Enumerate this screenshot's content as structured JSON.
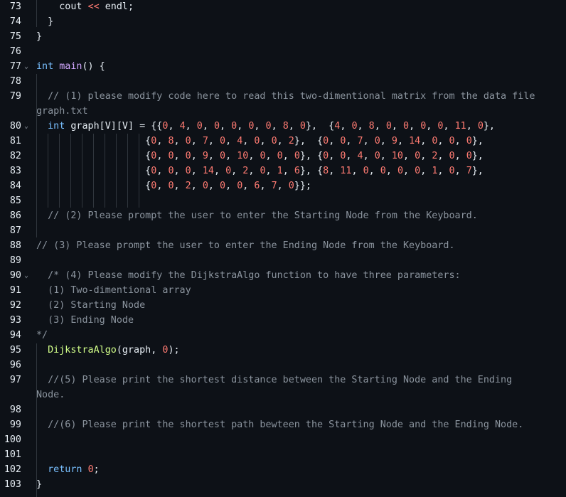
{
  "editor": {
    "lines": [
      {
        "n": "73",
        "fold": false,
        "segments": [
          [
            "plain",
            "    cout "
          ],
          [
            "op",
            "<<"
          ],
          [
            "plain",
            " endl;"
          ]
        ]
      },
      {
        "n": "74",
        "fold": false,
        "segments": [
          [
            "plain",
            "  }"
          ]
        ]
      },
      {
        "n": "75",
        "fold": false,
        "segments": [
          [
            "plain",
            "}"
          ]
        ]
      },
      {
        "n": "76",
        "fold": false,
        "segments": []
      },
      {
        "n": "77",
        "fold": true,
        "segments": [
          [
            "kw",
            "int"
          ],
          [
            "plain",
            " "
          ],
          [
            "fn",
            "main"
          ],
          [
            "plain",
            "() {"
          ]
        ]
      },
      {
        "n": "78",
        "fold": false,
        "segments": []
      },
      {
        "n": "79",
        "fold": false,
        "segments": [
          [
            "cm",
            "  // (1) please modify code here to read this two-dimentional matrix from the data file"
          ]
        ]
      },
      {
        "n": "",
        "fold": false,
        "segments": [
          [
            "cm",
            "graph.txt"
          ]
        ]
      },
      {
        "n": "80",
        "fold": true,
        "segments": [
          [
            "plain",
            "  "
          ],
          [
            "kw",
            "int"
          ],
          [
            "plain",
            " graph[V][V] = {{"
          ],
          [
            "num",
            "0"
          ],
          [
            "plain",
            ", "
          ],
          [
            "num",
            "4"
          ],
          [
            "plain",
            ", "
          ],
          [
            "num",
            "0"
          ],
          [
            "plain",
            ", "
          ],
          [
            "num",
            "0"
          ],
          [
            "plain",
            ", "
          ],
          [
            "num",
            "0"
          ],
          [
            "plain",
            ", "
          ],
          [
            "num",
            "0"
          ],
          [
            "plain",
            ", "
          ],
          [
            "num",
            "0"
          ],
          [
            "plain",
            ", "
          ],
          [
            "num",
            "8"
          ],
          [
            "plain",
            ", "
          ],
          [
            "num",
            "0"
          ],
          [
            "plain",
            "},  {"
          ],
          [
            "num",
            "4"
          ],
          [
            "plain",
            ", "
          ],
          [
            "num",
            "0"
          ],
          [
            "plain",
            ", "
          ],
          [
            "num",
            "8"
          ],
          [
            "plain",
            ", "
          ],
          [
            "num",
            "0"
          ],
          [
            "plain",
            ", "
          ],
          [
            "num",
            "0"
          ],
          [
            "plain",
            ", "
          ],
          [
            "num",
            "0"
          ],
          [
            "plain",
            ", "
          ],
          [
            "num",
            "0"
          ],
          [
            "plain",
            ", "
          ],
          [
            "num",
            "11"
          ],
          [
            "plain",
            ", "
          ],
          [
            "num",
            "0"
          ],
          [
            "plain",
            "},"
          ]
        ]
      },
      {
        "n": "81",
        "fold": false,
        "segments": [
          [
            "plain",
            "                   {"
          ],
          [
            "num",
            "0"
          ],
          [
            "plain",
            ", "
          ],
          [
            "num",
            "8"
          ],
          [
            "plain",
            ", "
          ],
          [
            "num",
            "0"
          ],
          [
            "plain",
            ", "
          ],
          [
            "num",
            "7"
          ],
          [
            "plain",
            ", "
          ],
          [
            "num",
            "0"
          ],
          [
            "plain",
            ", "
          ],
          [
            "num",
            "4"
          ],
          [
            "plain",
            ", "
          ],
          [
            "num",
            "0"
          ],
          [
            "plain",
            ", "
          ],
          [
            "num",
            "0"
          ],
          [
            "plain",
            ", "
          ],
          [
            "num",
            "2"
          ],
          [
            "plain",
            "},  {"
          ],
          [
            "num",
            "0"
          ],
          [
            "plain",
            ", "
          ],
          [
            "num",
            "0"
          ],
          [
            "plain",
            ", "
          ],
          [
            "num",
            "7"
          ],
          [
            "plain",
            ", "
          ],
          [
            "num",
            "0"
          ],
          [
            "plain",
            ", "
          ],
          [
            "num",
            "9"
          ],
          [
            "plain",
            ", "
          ],
          [
            "num",
            "14"
          ],
          [
            "plain",
            ", "
          ],
          [
            "num",
            "0"
          ],
          [
            "plain",
            ", "
          ],
          [
            "num",
            "0"
          ],
          [
            "plain",
            ", "
          ],
          [
            "num",
            "0"
          ],
          [
            "plain",
            "},"
          ]
        ]
      },
      {
        "n": "82",
        "fold": false,
        "segments": [
          [
            "plain",
            "                   {"
          ],
          [
            "num",
            "0"
          ],
          [
            "plain",
            ", "
          ],
          [
            "num",
            "0"
          ],
          [
            "plain",
            ", "
          ],
          [
            "num",
            "0"
          ],
          [
            "plain",
            ", "
          ],
          [
            "num",
            "9"
          ],
          [
            "plain",
            ", "
          ],
          [
            "num",
            "0"
          ],
          [
            "plain",
            ", "
          ],
          [
            "num",
            "10"
          ],
          [
            "plain",
            ", "
          ],
          [
            "num",
            "0"
          ],
          [
            "plain",
            ", "
          ],
          [
            "num",
            "0"
          ],
          [
            "plain",
            ", "
          ],
          [
            "num",
            "0"
          ],
          [
            "plain",
            "}, {"
          ],
          [
            "num",
            "0"
          ],
          [
            "plain",
            ", "
          ],
          [
            "num",
            "0"
          ],
          [
            "plain",
            ", "
          ],
          [
            "num",
            "4"
          ],
          [
            "plain",
            ", "
          ],
          [
            "num",
            "0"
          ],
          [
            "plain",
            ", "
          ],
          [
            "num",
            "10"
          ],
          [
            "plain",
            ", "
          ],
          [
            "num",
            "0"
          ],
          [
            "plain",
            ", "
          ],
          [
            "num",
            "2"
          ],
          [
            "plain",
            ", "
          ],
          [
            "num",
            "0"
          ],
          [
            "plain",
            ", "
          ],
          [
            "num",
            "0"
          ],
          [
            "plain",
            "},"
          ]
        ]
      },
      {
        "n": "83",
        "fold": false,
        "segments": [
          [
            "plain",
            "                   {"
          ],
          [
            "num",
            "0"
          ],
          [
            "plain",
            ", "
          ],
          [
            "num",
            "0"
          ],
          [
            "plain",
            ", "
          ],
          [
            "num",
            "0"
          ],
          [
            "plain",
            ", "
          ],
          [
            "num",
            "14"
          ],
          [
            "plain",
            ", "
          ],
          [
            "num",
            "0"
          ],
          [
            "plain",
            ", "
          ],
          [
            "num",
            "2"
          ],
          [
            "plain",
            ", "
          ],
          [
            "num",
            "0"
          ],
          [
            "plain",
            ", "
          ],
          [
            "num",
            "1"
          ],
          [
            "plain",
            ", "
          ],
          [
            "num",
            "6"
          ],
          [
            "plain",
            "}, {"
          ],
          [
            "num",
            "8"
          ],
          [
            "plain",
            ", "
          ],
          [
            "num",
            "11"
          ],
          [
            "plain",
            ", "
          ],
          [
            "num",
            "0"
          ],
          [
            "plain",
            ", "
          ],
          [
            "num",
            "0"
          ],
          [
            "plain",
            ", "
          ],
          [
            "num",
            "0"
          ],
          [
            "plain",
            ", "
          ],
          [
            "num",
            "0"
          ],
          [
            "plain",
            ", "
          ],
          [
            "num",
            "1"
          ],
          [
            "plain",
            ", "
          ],
          [
            "num",
            "0"
          ],
          [
            "plain",
            ", "
          ],
          [
            "num",
            "7"
          ],
          [
            "plain",
            "},"
          ]
        ]
      },
      {
        "n": "84",
        "fold": false,
        "segments": [
          [
            "plain",
            "                   {"
          ],
          [
            "num",
            "0"
          ],
          [
            "plain",
            ", "
          ],
          [
            "num",
            "0"
          ],
          [
            "plain",
            ", "
          ],
          [
            "num",
            "2"
          ],
          [
            "plain",
            ", "
          ],
          [
            "num",
            "0"
          ],
          [
            "plain",
            ", "
          ],
          [
            "num",
            "0"
          ],
          [
            "plain",
            ", "
          ],
          [
            "num",
            "0"
          ],
          [
            "plain",
            ", "
          ],
          [
            "num",
            "6"
          ],
          [
            "plain",
            ", "
          ],
          [
            "num",
            "7"
          ],
          [
            "plain",
            ", "
          ],
          [
            "num",
            "0"
          ],
          [
            "plain",
            "}};"
          ]
        ]
      },
      {
        "n": "85",
        "fold": false,
        "segments": []
      },
      {
        "n": "86",
        "fold": false,
        "segments": [
          [
            "cm",
            "  // (2) Please prompt the user to enter the Starting Node from the Keyboard."
          ]
        ]
      },
      {
        "n": "87",
        "fold": false,
        "segments": []
      },
      {
        "n": "88",
        "fold": false,
        "segments": [
          [
            "cm",
            "// (3) Please prompt the user to enter the Ending Node from the Keyboard."
          ]
        ]
      },
      {
        "n": "89",
        "fold": false,
        "segments": []
      },
      {
        "n": "90",
        "fold": true,
        "segments": [
          [
            "cm",
            "  /* (4) Please modify the DijkstraAlgo function to have three parameters:"
          ]
        ]
      },
      {
        "n": "91",
        "fold": false,
        "segments": [
          [
            "cm",
            "  (1) Two-dimentional array"
          ]
        ]
      },
      {
        "n": "92",
        "fold": false,
        "segments": [
          [
            "cm",
            "  (2) Starting Node"
          ]
        ]
      },
      {
        "n": "93",
        "fold": false,
        "segments": [
          [
            "cm",
            "  (3) Ending Node"
          ]
        ]
      },
      {
        "n": "94",
        "fold": false,
        "segments": [
          [
            "cm",
            "*/"
          ]
        ]
      },
      {
        "n": "95",
        "fold": false,
        "segments": [
          [
            "plain",
            "  "
          ],
          [
            "fn2",
            "DijkstraAlgo"
          ],
          [
            "plain",
            "(graph, "
          ],
          [
            "num",
            "0"
          ],
          [
            "plain",
            ");"
          ]
        ]
      },
      {
        "n": "96",
        "fold": false,
        "segments": []
      },
      {
        "n": "97",
        "fold": false,
        "segments": [
          [
            "cm",
            "  //(5) Please print the shortest distance between the Starting Node and the Ending"
          ]
        ]
      },
      {
        "n": "",
        "fold": false,
        "segments": [
          [
            "cm",
            "Node."
          ]
        ]
      },
      {
        "n": "98",
        "fold": false,
        "segments": []
      },
      {
        "n": "99",
        "fold": false,
        "segments": [
          [
            "cm",
            "  //(6) Please print the shortest path bewteen the Starting Node and the Ending Node."
          ]
        ]
      },
      {
        "n": "100",
        "fold": false,
        "segments": []
      },
      {
        "n": "101",
        "fold": false,
        "segments": []
      },
      {
        "n": "102",
        "fold": false,
        "segments": [
          [
            "plain",
            "  "
          ],
          [
            "kw",
            "return"
          ],
          [
            "plain",
            " "
          ],
          [
            "num",
            "0"
          ],
          [
            "plain",
            ";"
          ]
        ]
      },
      {
        "n": "103",
        "fold": false,
        "segments": [
          [
            "plain",
            "}"
          ]
        ]
      }
    ]
  }
}
